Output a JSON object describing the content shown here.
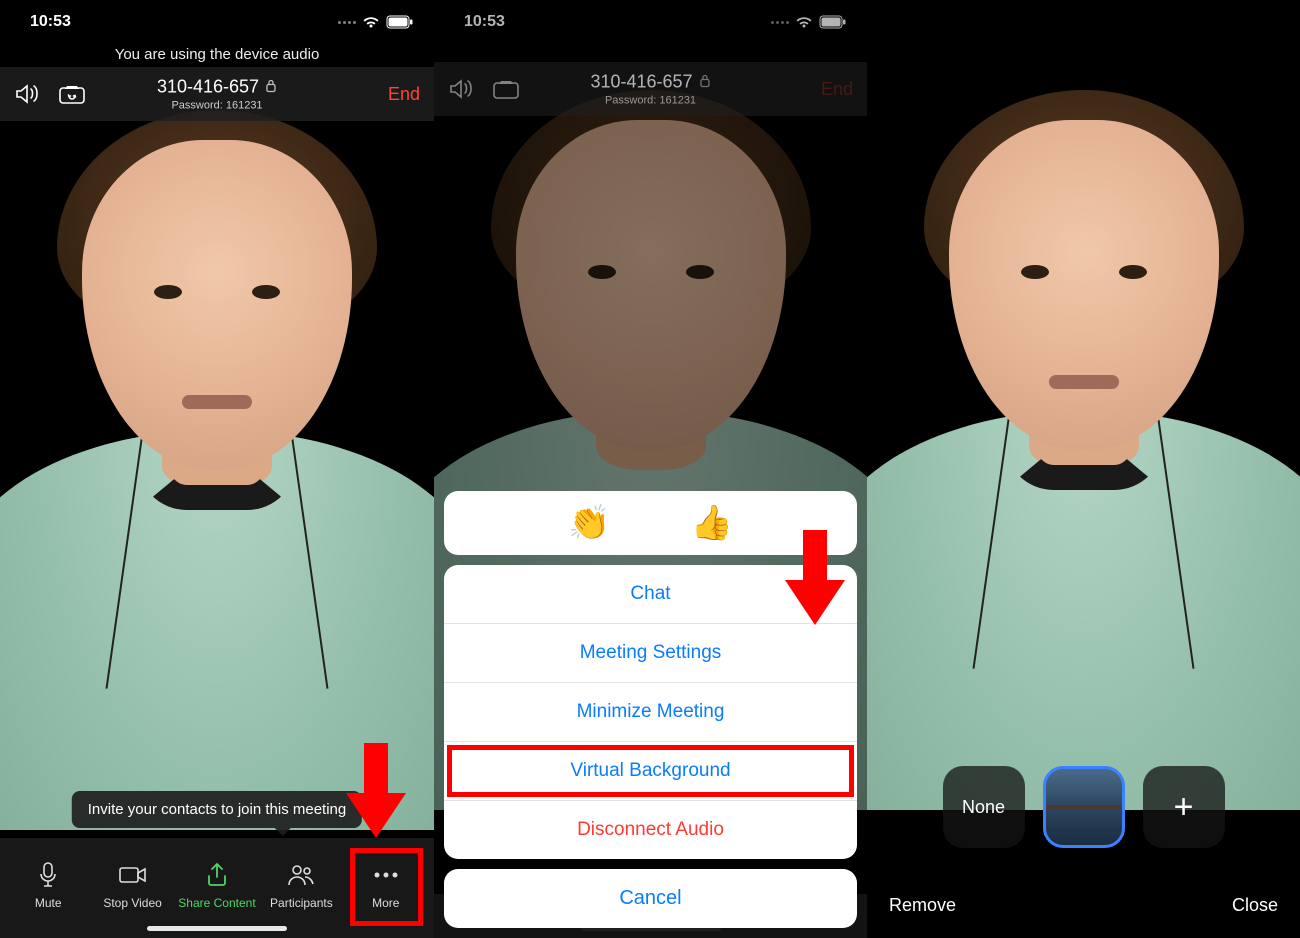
{
  "status": {
    "time": "10:53"
  },
  "banner": "You are using the device audio",
  "meeting": {
    "id": "310-416-657",
    "password_label": "Password: 161231",
    "end": "End"
  },
  "tooltip": "Invite your contacts to join this meeting",
  "toolbar": {
    "mute": "Mute",
    "stop_video": "Stop Video",
    "share_content": "Share Content",
    "participants": "Participants",
    "more": "More"
  },
  "sheet": {
    "reactions": {
      "clap": "👏",
      "thumbs": "👍"
    },
    "chat": "Chat",
    "settings": "Meeting Settings",
    "minimize": "Minimize Meeting",
    "virtual_bg": "Virtual Background",
    "disconnect": "Disconnect Audio",
    "cancel": "Cancel"
  },
  "bg_selector": {
    "none": "None",
    "add": "+"
  },
  "bottom_actions": {
    "remove": "Remove",
    "close": "Close"
  }
}
